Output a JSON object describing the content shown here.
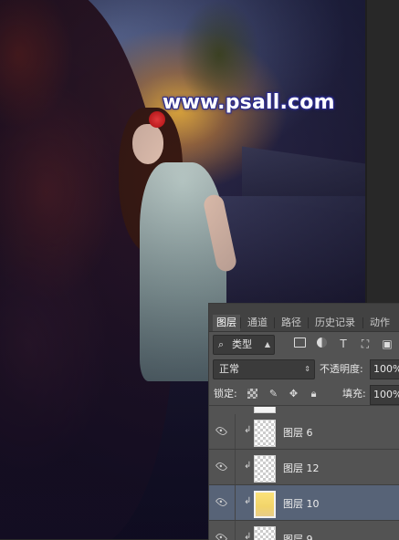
{
  "canvas": {
    "watermark": "www.psall.com"
  },
  "layers_panel": {
    "tabs": [
      {
        "label": "图层",
        "active": true
      },
      {
        "label": "通道",
        "active": false
      },
      {
        "label": "路径",
        "active": false
      },
      {
        "label": "历史记录",
        "active": false
      },
      {
        "label": "动作",
        "active": false
      }
    ],
    "filter": {
      "kind_label": "类型",
      "icons": [
        "image-filter-icon",
        "adjustment-filter-icon",
        "type-filter-icon",
        "shape-filter-icon",
        "smart-object-filter-icon"
      ],
      "type_glyph": "T"
    },
    "blend_mode": "正常",
    "opacity_label": "不透明度:",
    "opacity_value": "100%",
    "lock_label": "锁定:",
    "fill_label": "填充:",
    "fill_value": "100%",
    "layers": [
      {
        "name": "图层 6",
        "visible": true,
        "clipped": true,
        "thumb": "transparent",
        "selected": false
      },
      {
        "name": "图层 12",
        "visible": true,
        "clipped": true,
        "thumb": "transparent",
        "selected": false
      },
      {
        "name": "图层 10",
        "visible": true,
        "clipped": true,
        "thumb": "yellow",
        "selected": true
      },
      {
        "name": "图层 9",
        "visible": true,
        "clipped": true,
        "thumb": "transparent",
        "selected": false
      }
    ]
  }
}
